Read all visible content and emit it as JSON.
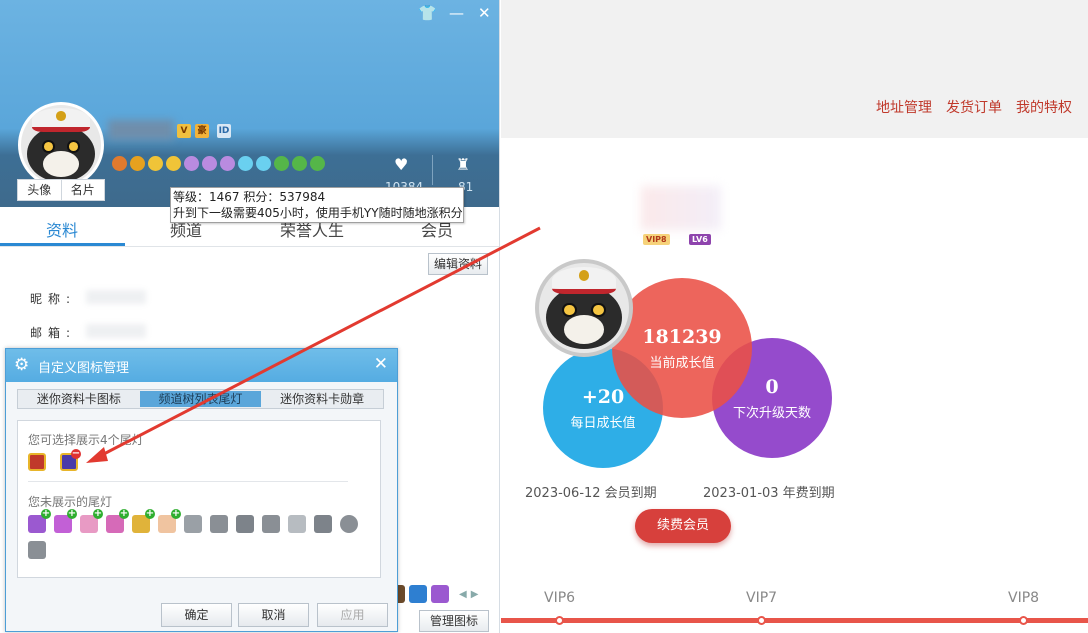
{
  "window": {
    "skin_icon": "shirt-icon",
    "minimize_icon": "minimize-icon",
    "close_icon": "close-icon"
  },
  "profile": {
    "avatar_tabs": [
      "头像",
      "名片"
    ],
    "stats": {
      "likes_count": "10384",
      "rank_count": "81"
    }
  },
  "tooltip": {
    "line1": "等级：1467 积分：537984",
    "line2": "升到下一级需要405小时，使用手机YY随时随地涨积分"
  },
  "tabs": [
    "资料",
    "频道",
    "荣誉人生",
    "会员"
  ],
  "edit_button": "编辑资料",
  "fields": {
    "nickname_label": "昵称:",
    "email_label": "邮箱:"
  },
  "manage_icons_button": "管理图标",
  "dialog": {
    "title": "自定义图标管理",
    "tabs": [
      "迷你资料卡图标",
      "频道树列表尾灯",
      "迷你资料卡勋章"
    ],
    "active_tab": 1,
    "shown_title": "您可选择展示4个尾灯",
    "hidden_title": "您未展示的尾灯",
    "buttons": {
      "ok": "确定",
      "cancel": "取消",
      "apply": "应用"
    }
  },
  "vip": {
    "top_links": [
      "地址管理",
      "发货订单",
      "我的特权"
    ],
    "badges": [
      "VIP8",
      "LV6"
    ],
    "current_growth": {
      "value": "181239",
      "label": "当前成长值"
    },
    "daily_growth": {
      "value": "+20",
      "label": "每日成长值"
    },
    "days_to_upgrade": {
      "value": "0",
      "label": "下次升级天数"
    },
    "member_expiry": "2023-06-12 会员到期",
    "annual_expiry": "2023-01-03 年费到期",
    "renew_button": "续费会员",
    "levels": [
      "VIP6",
      "VIP7",
      "VIP8"
    ],
    "accent_color": "#d7403c"
  }
}
